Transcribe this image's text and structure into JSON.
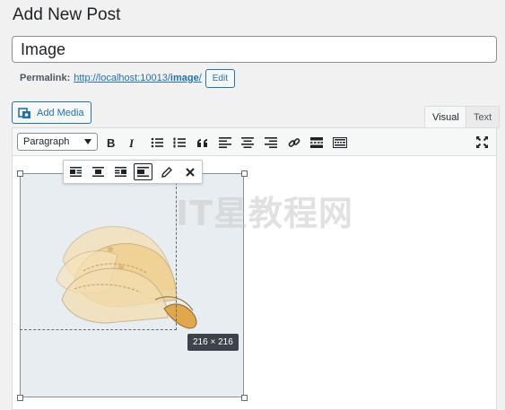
{
  "page": {
    "title": "Add New Post"
  },
  "post": {
    "title_value": "Image"
  },
  "permalink": {
    "label": "Permalink:",
    "url_base": "http://localhost:10013/",
    "url_slug": "image",
    "url_end": "/",
    "edit_label": "Edit"
  },
  "media": {
    "add_label": "Add Media"
  },
  "tabs": {
    "visual": "Visual",
    "text": "Text"
  },
  "toolbar": {
    "format_value": "Paragraph",
    "buttons": [
      "bold-icon",
      "italic-icon",
      "bullet-list-icon",
      "numbered-list-icon",
      "blockquote-icon",
      "align-left-icon",
      "align-center-icon",
      "align-right-icon",
      "link-icon",
      "read-more-icon",
      "toolbar-toggle-icon"
    ],
    "fullscreen": "fullscreen-icon"
  },
  "image_toolbar": {
    "buttons": [
      "align-left-icon",
      "align-center-icon",
      "align-right-icon",
      "align-none-icon",
      "edit-pencil-icon",
      "remove-icon"
    ],
    "active": "align-none-icon"
  },
  "image": {
    "dimensions": "216 × 216",
    "subject": "baseball-cap"
  },
  "watermark": {
    "text": "IT星教程网"
  },
  "colors": {
    "accent": "#2271b1",
    "text": "#1d2327",
    "border": "#8c8f94"
  }
}
